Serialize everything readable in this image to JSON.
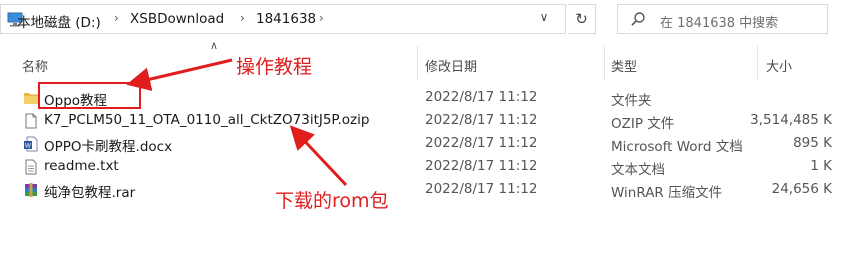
{
  "address_bar": {
    "crumbs": [
      "本地磁盘 (D:)",
      "XSBDownload",
      "1841638"
    ],
    "icon": "this-pc-icon"
  },
  "search": {
    "placeholder": "在 1841638 中搜索",
    "icon": "search-icon"
  },
  "columns": {
    "name": "名称",
    "date": "修改日期",
    "type": "类型",
    "size": "大小"
  },
  "files": [
    {
      "name": "Oppo教程",
      "date": "2022/8/17 11:12",
      "type": "文件夹",
      "size": "",
      "icon": "folder-icon"
    },
    {
      "name": "K7_PCLM50_11_OTA_0110_all_CktZO73itJ5P.ozip",
      "date": "2022/8/17 11:12",
      "type": "OZIP 文件",
      "size": "3,514,485 K",
      "icon": "file-icon"
    },
    {
      "name": "OPPO卡刷教程.docx",
      "date": "2022/8/17 11:12",
      "type": "Microsoft Word 文档",
      "size": "895 K",
      "icon": "word-doc-icon"
    },
    {
      "name": "readme.txt",
      "date": "2022/8/17 11:12",
      "type": "文本文档",
      "size": "1 K",
      "icon": "text-file-icon"
    },
    {
      "name": "纯净包教程.rar",
      "date": "2022/8/17 11:12",
      "type": "WinRAR 压缩文件",
      "size": "24,656 K",
      "icon": "winrar-archive-icon"
    }
  ],
  "annotations": {
    "tutorial_label": "操作教程",
    "rom_label": "下载的rom包",
    "color": "#e11d1d"
  }
}
